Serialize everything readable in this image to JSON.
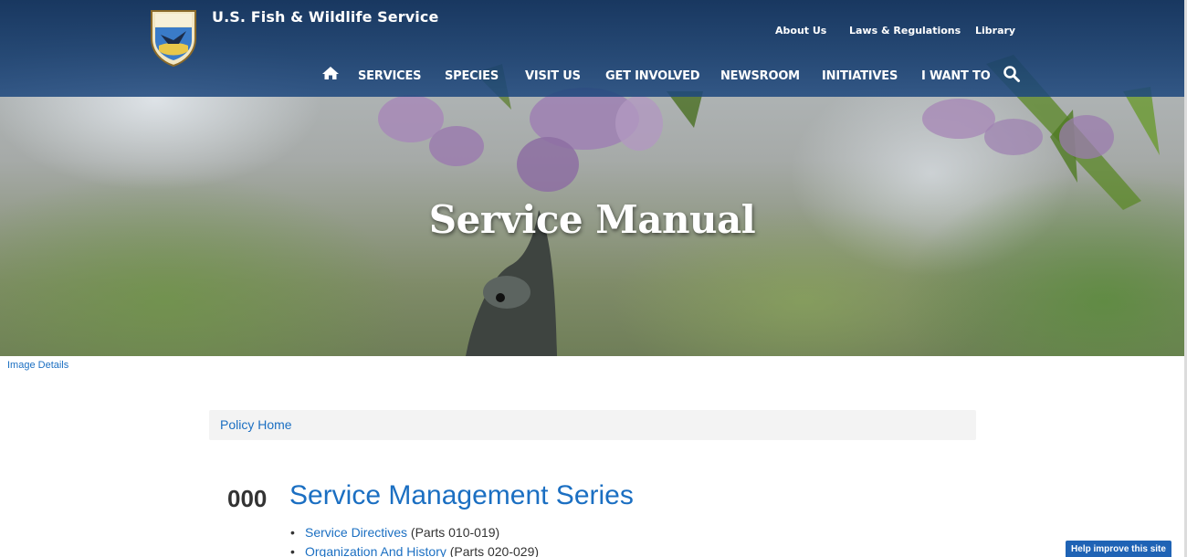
{
  "header": {
    "site_title": "U.S. Fish & Wildlife Service",
    "logo_text": "U.S. FISH & WILDLIFE SERVICE",
    "utility_links": [
      "About Us",
      "Laws & Regulations",
      "Library"
    ],
    "main_nav": [
      "SERVICES",
      "SPECIES",
      "VISIT US",
      "GET INVOLVED",
      "NEWSROOM",
      "INITIATIVES",
      "I WANT TO"
    ],
    "icons": {
      "home": "home-icon",
      "search": "search-icon"
    }
  },
  "hero": {
    "title": "Service Manual",
    "image_details_link": "Image Details"
  },
  "breadcrumb": {
    "home": "Policy Home"
  },
  "series": {
    "number": "000",
    "title": "Service Management Series",
    "items": [
      {
        "label": "Service Directives",
        "range": "(Parts 010-019)"
      },
      {
        "label": "Organization And History",
        "range": "(Parts 020-029)"
      }
    ]
  },
  "feedback": {
    "button_label": "Help improve this site"
  },
  "colors": {
    "link_blue": "#1b6fc2",
    "header_blue": "#163c6c",
    "help_button": "#1f63b5"
  }
}
